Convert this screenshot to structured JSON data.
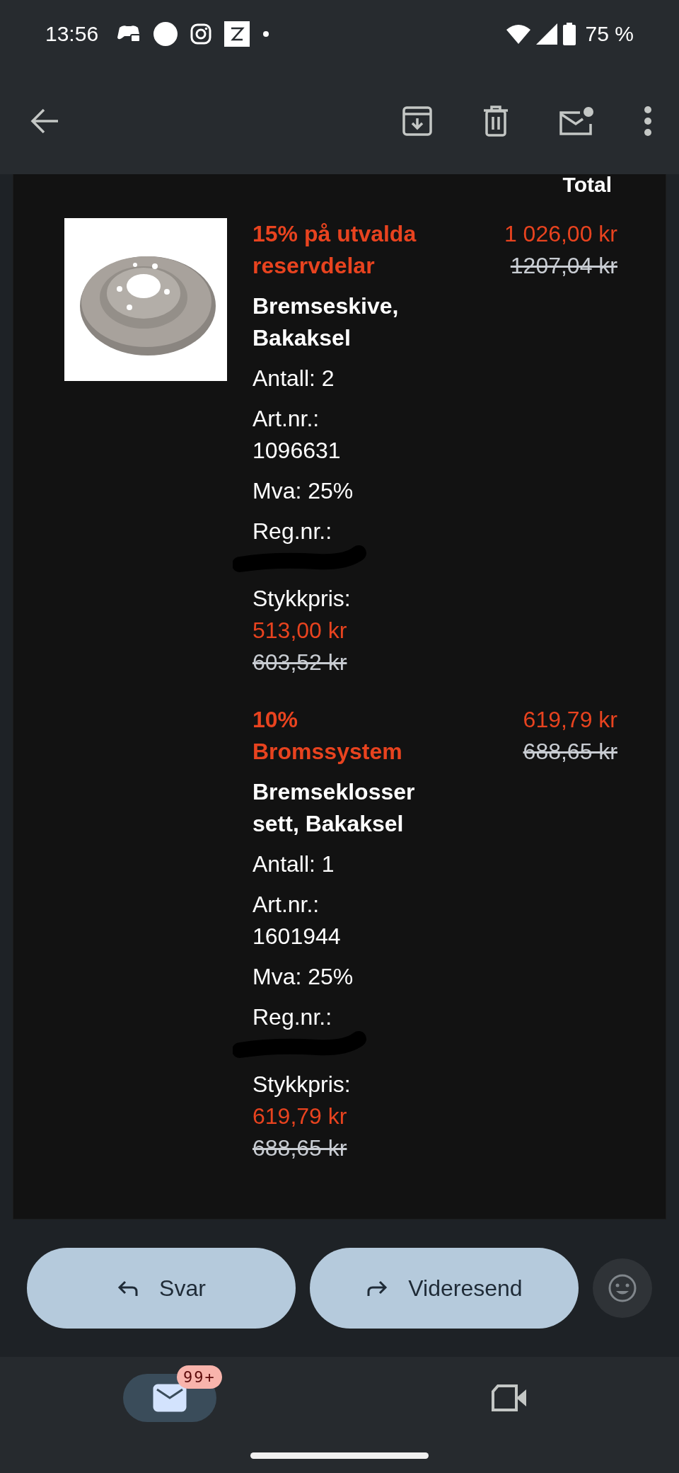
{
  "status_bar": {
    "time": "13:56",
    "battery": "75 %"
  },
  "email": {
    "column_header": "Total",
    "items": [
      {
        "promo": "15% på utvalda reservdelar",
        "name": "Bremseskive, Bakaksel",
        "quantity": "Antall: 2",
        "article_label": "Art.nr.:",
        "article_number": "1096631",
        "vat": "Mva: 25%",
        "reg_label": "Reg.nr.:",
        "unit_price_label": "Stykkpris:",
        "unit_price": "513,00 kr",
        "unit_price_original": "603,52 kr",
        "total": "1 026,00 kr",
        "total_original": "1207,04 kr"
      },
      {
        "promo": "10% Bromssystem",
        "name": "Bremseklosser sett, Bakaksel",
        "quantity": "Antall: 1",
        "article_label": "Art.nr.:",
        "article_number": "1601944",
        "vat": "Mva: 25%",
        "reg_label": "Reg.nr.:",
        "unit_price_label": "Stykkpris:",
        "unit_price": "619,79 kr",
        "unit_price_original": "688,65 kr",
        "total": "619,79 kr",
        "total_original": "688,65 kr"
      }
    ]
  },
  "actions": [
    {
      "kind": "reply",
      "label": "Svar"
    },
    {
      "kind": "forward",
      "label": "Videresend"
    }
  ],
  "bottom_nav": [
    {
      "kind": "mail",
      "selected": true,
      "badge": "99+"
    },
    {
      "kind": "video",
      "selected": false
    }
  ]
}
